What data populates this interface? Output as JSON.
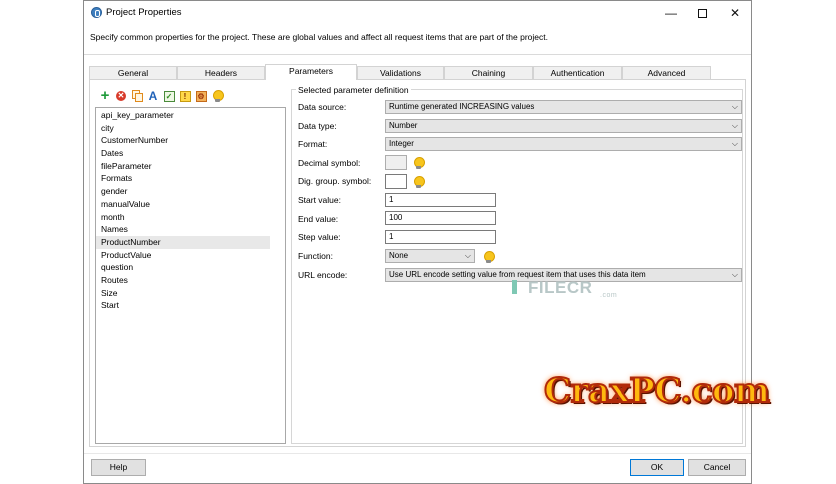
{
  "window": {
    "title": "Project Properties",
    "icon": "project-globe-icon",
    "controls": {
      "minimize": "—",
      "close": "✕"
    }
  },
  "description": "Specify common properties for the project. These are global values and affect all request items that are part of the project.",
  "tabs": [
    {
      "label": "General"
    },
    {
      "label": "Headers"
    },
    {
      "label": "Parameters",
      "active": true
    },
    {
      "label": "Validations"
    },
    {
      "label": "Chaining"
    },
    {
      "label": "Authentication"
    },
    {
      "label": "Advanced"
    }
  ],
  "toolbar": {
    "icons": [
      "add-icon",
      "remove-icon",
      "copy-icon",
      "rename-icon",
      "check-icon",
      "warning-icon",
      "settings-icon",
      "hint-bulb-icon"
    ],
    "remove_glyph": "✕",
    "rename_glyph": "A",
    "check_glyph": "✓",
    "warn_glyph": "!",
    "settings_glyph": "⚙"
  },
  "parameters": {
    "items": [
      "api_key_parameter",
      "city",
      "CustomerNumber",
      "Dates",
      "fileParameter",
      "Formats",
      "gender",
      "manualValue",
      "month",
      "Names",
      "ProductNumber",
      "ProductValue",
      "question",
      "Routes",
      "Size",
      "Start"
    ],
    "selected": "ProductNumber"
  },
  "definition": {
    "legend": "Selected parameter definition",
    "data_source_label": "Data source:",
    "data_source_value": "Runtime generated INCREASING values",
    "data_type_label": "Data type:",
    "data_type_value": "Number",
    "format_label": "Format:",
    "format_value": "Integer",
    "decimal_symbol_label": "Decimal symbol:",
    "dig_group_label": "Dig. group. symbol:",
    "start_label": "Start value:",
    "start_value": "1",
    "end_label": "End value:",
    "end_value": "100",
    "step_label": "Step value:",
    "step_value": "1",
    "function_label": "Function:",
    "function_value": "None",
    "url_encode_label": "URL encode:",
    "url_encode_value": "Use URL encode setting value from request item that uses this data item"
  },
  "footer": {
    "help": "Help",
    "ok": "OK",
    "cancel": "Cancel"
  },
  "watermarks": {
    "filecr": "FILECR",
    "filecr_suffix": ".com",
    "crax": "CraxPC.com"
  },
  "colors": {
    "accent": "#0078d7",
    "add_green": "#1e9a3a",
    "remove_red": "#d83a2a",
    "bulb_yellow": "#f7c51d"
  }
}
